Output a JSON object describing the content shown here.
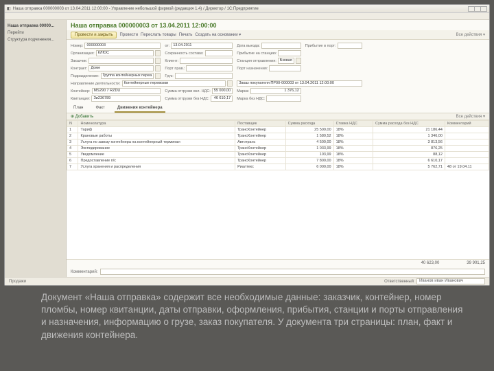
{
  "window": {
    "title": "Наша отправка 000000003 от 13.04.2011 12:00:00 - Управление небольшой фирмой (редакция 1.4) / Директор / 1С:Предприятие"
  },
  "nav": {
    "items": [
      "Наша отправка 00000...",
      "Перейти",
      "Структура подчинения..."
    ]
  },
  "doc": {
    "title": "Наша отправка 000000003 от 13.04.2011 12:00:00",
    "toolbar": {
      "post": "Провести и закрыть",
      "post_only": "Провести",
      "reassign": "Переслать товары",
      "print": "Печать",
      "create_based": "Создать на основании ▾",
      "all_actions": "Все действия ▾"
    },
    "fields": {
      "number_label": "Номер:",
      "number": "000000003",
      "date_label": "от:",
      "date": "13.04.2011",
      "departure_label": "Дата выезда:",
      "departure": "",
      "arrival_label": "Прибытие в порт:",
      "arrival": "",
      "org_label": "Организация:",
      "org": "КЛЮС",
      "storage_label": "Сохранность состава:",
      "storage": "",
      "sender_behalf_label": "Прибытие на станцию:",
      "sender_behalf": "",
      "customer_label": "Заказчик:",
      "customer": "",
      "client_label": "Клиент:",
      "client": "",
      "sender_label": "Станция отправления:",
      "sender": "Бзовая",
      "contract_label": "Контракт:",
      "contract": "Доме",
      "porto_label": "Порт прав.:",
      "porto": "",
      "dest_label": "Порт назначения:",
      "dest": "",
      "subdivision_label": "Подразделение:",
      "subdivision": "Группа контейнерных переа",
      "cargo_label": "Груз:",
      "cargo": "",
      "activity_label": "Направление деятельности:",
      "activity": "Контейнерные перевозки",
      "order_label": "",
      "order": "Заказ покупателя ПР00-000003 от 13.04.2011 12:00:00",
      "container_label": "Контейнер:",
      "container": "МS290 7 RZDU",
      "sum_nds_label": "Сумма отгрузки вкл. НДС:",
      "sum_nds": "55 000,00",
      "brand_label": "Марка:",
      "brand": "1 376,12",
      "receipt_label": "Квитанция:",
      "receipt": "Зи236789",
      "sum_wo_nds_label": "Сумма отгрузки без НДС:",
      "sum_wo_nds": "46 610,17",
      "brand2_label": "Марка без НДС:",
      "brand2": ""
    },
    "tabs": [
      "План",
      "Факт",
      "Движения контейнера"
    ],
    "active_tab": 2,
    "gridbar": {
      "add": "Добавить",
      "all": "Все действия ▾"
    },
    "columns": [
      "N",
      "Номенклатура",
      "Поставщик",
      "Сумма расхода",
      "Ставка НДС",
      "Сумма расхода без НДС",
      "Комментарий"
    ],
    "rows": [
      {
        "n": "1",
        "name": "Тариф",
        "supplier": "ТрансКонтейнер",
        "sum": "25 500,00",
        "nds": "18%",
        "sum_wo": "21 186,44",
        "comment": ""
      },
      {
        "n": "2",
        "name": "Крановые работы",
        "supplier": "ТрансКонтейнер",
        "sum": "1 580,52",
        "nds": "18%",
        "sum_wo": "1 346,00",
        "comment": ""
      },
      {
        "n": "3",
        "name": "Услуга по завозу контейнера на контейнерный терминал",
        "supplier": "Автотранс",
        "sum": "4 500,00",
        "nds": "18%",
        "sum_wo": "3 813,56",
        "comment": ""
      },
      {
        "n": "4",
        "name": "Экспедирование",
        "supplier": "ТрансКонтейнер",
        "sum": "1 033,99",
        "nds": "18%",
        "sum_wo": "876,25",
        "comment": ""
      },
      {
        "n": "5",
        "name": "Уведомление",
        "supplier": "ТрансКонтейнер",
        "sum": "103,99",
        "nds": "18%",
        "sum_wo": "88,12",
        "comment": ""
      },
      {
        "n": "6",
        "name": "Предоставление п/с",
        "supplier": "ТрансКонтейнер",
        "sum": "7 800,00",
        "nds": "18%",
        "sum_wo": "6 610,17",
        "comment": ""
      },
      {
        "n": "7",
        "name": "Услуга хранения и распределения",
        "supplier": "Риалтекс",
        "sum": "6 000,00",
        "nds": "18%",
        "sum_wo": "5 762,71",
        "comment": "48 от 19.04.11"
      }
    ],
    "totals": {
      "sum": "40 623,00",
      "sum_wo": "39 901,25"
    },
    "comment_label": "Комментарий:"
  },
  "status": {
    "sales": "Продажи",
    "resp_label": "Ответственный",
    "resp": "Иванов иван Иванович"
  },
  "caption": "Документ «Наша отправка» содержит все необходимые данные: заказчик, контейнер, номер пломбы, номер квитанции, даты отправки, оформления, прибытия, станции и порты отправления и назначения, информацию о грузе, заказ покупателя. У документа три  страницы: план, факт и движения контейнера."
}
